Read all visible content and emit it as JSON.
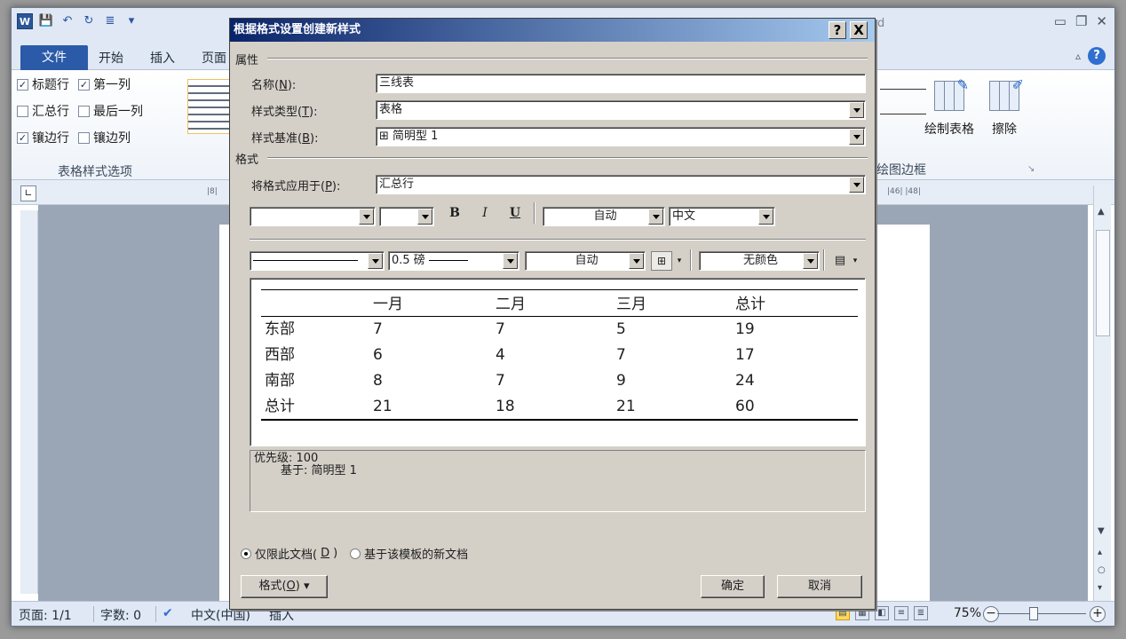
{
  "app": {
    "title_tail": "d",
    "qat": {
      "word_icon_label": "W"
    },
    "tabs": {
      "file": "文件",
      "home": "开始",
      "insert": "插入",
      "page": "页面"
    }
  },
  "ribbon": {
    "options": [
      {
        "label": "标题行",
        "checked": "✓"
      },
      {
        "label": "第一列",
        "checked": "✓"
      },
      {
        "label": "汇总行",
        "checked": ""
      },
      {
        "label": "最后一列",
        "checked": ""
      },
      {
        "label": "镶边行",
        "checked": "✓"
      },
      {
        "label": "镶边列",
        "checked": ""
      }
    ],
    "options_group_label": "表格样式选项",
    "draw_table": "绘制表格",
    "erase": "擦除",
    "borders_group_label": "绘图边框"
  },
  "ruler": {
    "frag_left": "|8|",
    "frag_right": "|46| |48|"
  },
  "status": {
    "page": "页面: 1/1",
    "words": "字数: 0",
    "lang": "中文(中国)",
    "mode": "插入",
    "zoom": "75%"
  },
  "dialog": {
    "title": "根据格式设置创建新样式",
    "help": "?",
    "close": "X",
    "props_section": "属性",
    "name_label": "名称(",
    "name_key": "N",
    "name_tail": "):",
    "name_value": "三线表",
    "type_label": "样式类型(",
    "type_key": "T",
    "type_tail": "):",
    "type_value": "表格",
    "base_label": "样式基准(",
    "base_key": "B",
    "base_tail": "):",
    "base_value": "⊞ 简明型 1",
    "format_section": "格式",
    "apply_label": "将格式应用于(",
    "apply_key": "P",
    "apply_tail": "):",
    "apply_value": "汇总行",
    "font_name": "",
    "font_size": "",
    "bold": "B",
    "italic": "I",
    "underline": "U",
    "font_color": "自动",
    "script": "中文",
    "border_width": "0.5 磅",
    "border_color": "自动",
    "shading": "无颜色",
    "preview": {
      "header": [
        "",
        "一月",
        "二月",
        "三月",
        "总计"
      ],
      "rows": [
        [
          "东部",
          "7",
          "7",
          "5",
          "19"
        ],
        [
          "西部",
          "6",
          "4",
          "7",
          "17"
        ],
        [
          "南部",
          "8",
          "7",
          "9",
          "24"
        ],
        [
          "总计",
          "21",
          "18",
          "21",
          "60"
        ]
      ]
    },
    "desc_line1": "优先级: 100",
    "desc_line2": "基于: 简明型 1",
    "radio_this_doc": "仅限此文档(",
    "radio_this_key": "D",
    "radio_this_tail": ")",
    "radio_template": "基于该模板的新文档",
    "format_btn": "格式(",
    "format_key": "O",
    "format_tail": ") ▾",
    "ok": "确定",
    "cancel": "取消"
  }
}
